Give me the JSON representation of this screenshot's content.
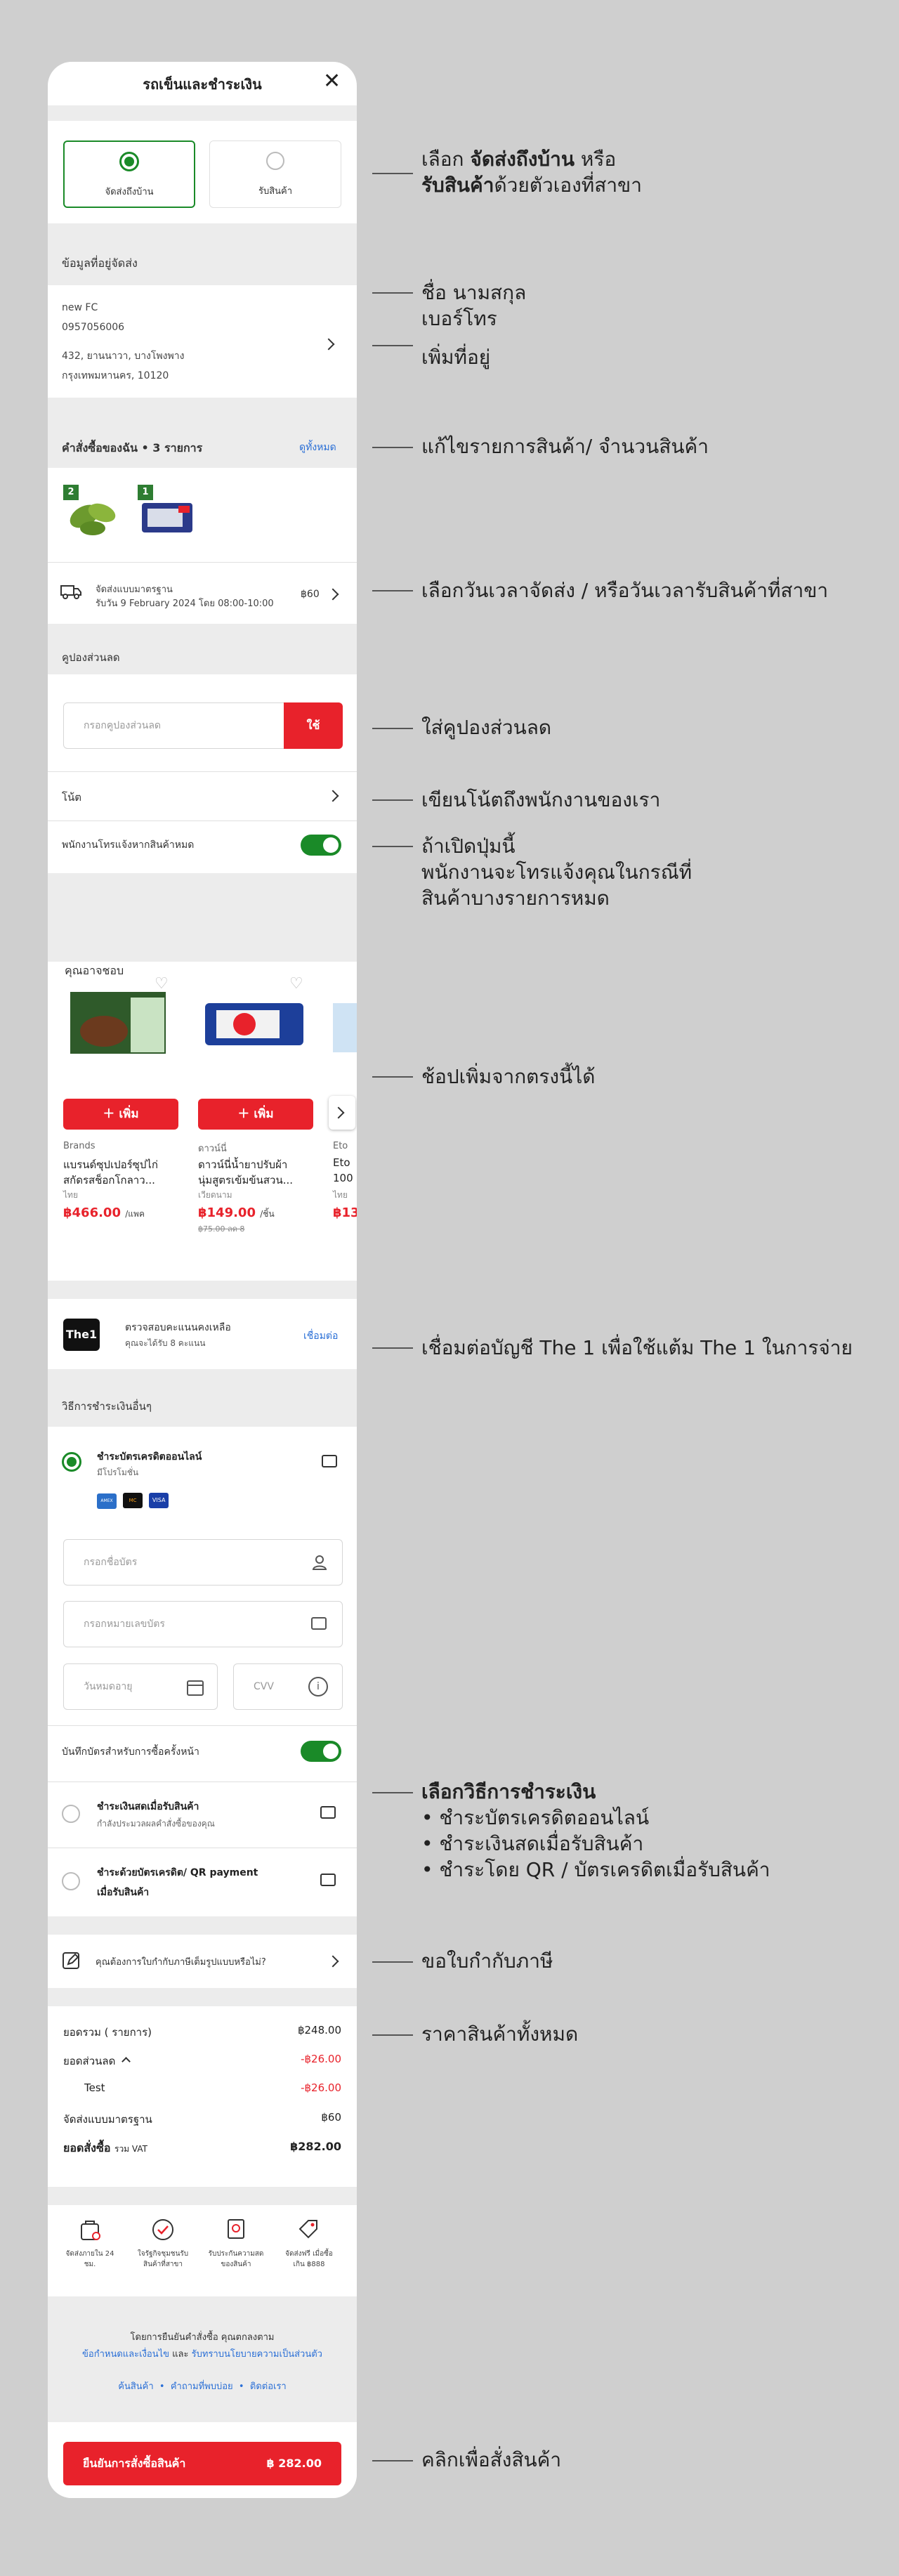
{
  "header": {
    "title": "รถเข็นและชำระเงิน"
  },
  "delivery": {
    "home_label": "จัดส่งถึงบ้าน",
    "pickup_label": "รับสินค้า"
  },
  "address": {
    "section_title": "ข้อมูลที่อยู่จัดส่ง",
    "name": "new FC",
    "phone": "0957056006",
    "line1": "432, ยานนาวา, บางโพงพาง",
    "line2": "กรุงเทพมหานคร, 10120"
  },
  "order": {
    "section_title": "คำสั่งซื้อของฉัน • 3 รายการ",
    "view_all": "ดูทั้งหมด",
    "item1_qty": "2",
    "item2_qty": "1",
    "shipping_title": "จัดส่งแบบมาตรฐาน",
    "shipping_date": "รับวัน 9 February 2024 โดย 08:00-10:00",
    "shipping_price": "฿60"
  },
  "coupon": {
    "section_title": "คูปองส่วนลด",
    "placeholder": "กรอกคูปองส่วนลด",
    "apply_label": "ใช้"
  },
  "note": {
    "label": "โน้ต"
  },
  "staff_call": {
    "label": "พนักงานโทรแจ้งหากสินค้าหมด"
  },
  "recommend": {
    "title": "คุณอาจชอบ",
    "products": [
      {
        "add_label": "เพิ่ม",
        "brand": "Brands",
        "name1": "แบรนด์ซุปเปอร์ซุปไก่",
        "name2": "สกัดรสช็อกโกลาว...",
        "origin": "ไทย",
        "price": "฿466.00",
        "unit": "/แพค",
        "old_price": ""
      },
      {
        "add_label": "เพิ่ม",
        "brand": "ดาวน์นี่",
        "name1": "ดาวน์นี่น้ำยาปรับผ้า",
        "name2": "นุ่มสูตรเข้มข้นสวน...",
        "origin": "เวียดนาม",
        "price": "฿149.00",
        "unit": "/ชิ้น",
        "old_price": "฿75.00 ลด 8"
      },
      {
        "add_label": "",
        "brand": "Eto",
        "name1": "Eto",
        "name2": "100",
        "origin": "ไทย",
        "price": "฿13",
        "unit": "",
        "old_price": ""
      }
    ]
  },
  "the1": {
    "logo": "The1",
    "title": "ตรวจสอบคะแนนคงเหลือ",
    "subtitle": "คุณจะได้รับ 8 คะแนน",
    "link": "เชื่อมต่อ"
  },
  "payment": {
    "section_title": "วิธีการชำระเงินอื่นๆ",
    "card_title": "ชำระบัตรเครดิตออนไลน์",
    "card_sub": "มีโปรโมชั่น",
    "card_logos": [
      "AMEX",
      "MC",
      "VISA"
    ],
    "card_name_ph": "กรอกชื่อบัตร",
    "card_number_ph": "กรอกหมายเลขบัตร",
    "expiry_ph": "วันหมดอายุ",
    "cvv_ph": "CVV",
    "save_card": "บันทึกบัตรสำหรับการซื้อครั้งหน้า",
    "cod_title": "ชำระเงินสดเมื่อรับสินค้า",
    "cod_sub": "กำลังประมวลผลคำสั่งซื้อของคุณ",
    "qr_title1": "ชำระด้วยบัตรเครดิต/ QR payment",
    "qr_title2": "เมื่อรับสินค้า"
  },
  "tax": {
    "label": "คุณต้องการใบกำกับภาษีเต็มรูปแบบหรือไม่?"
  },
  "summary": {
    "subtotal_label": "ยอดรวม ( รายการ)",
    "subtotal": "฿248.00",
    "discount_label": "ยอดส่วนลด",
    "discount": "-฿26.00",
    "test_label": "Test",
    "test_value": "-฿26.00",
    "shipping_label": "จัดส่งแบบมาตรฐาน",
    "shipping": "฿60",
    "total_label": "ยอดสั่งซื้อ",
    "vat": "รวม VAT",
    "total": "฿282.00"
  },
  "benefits": [
    {
      "line1": "จัดส่งภายใน 24",
      "line2": "ชม."
    },
    {
      "line1": "ใจรัฐกิจชุมชนรับ",
      "line2": "สินค้าที่สาขา"
    },
    {
      "line1": "รับประกันความสด",
      "line2": "ของสินค้า"
    },
    {
      "line1": "จัดส่งฟรี เมื่อซื้อ",
      "line2": "เกิน ฿888"
    }
  ],
  "terms": {
    "line1": "โดยการยืนยันคำสั่งซื้อ คุณตกลงตาม",
    "line2a": "ข้อกำหนดและเงื่อนไข",
    "line2b": " และ ",
    "line2c": "รับทราบนโยบายความเป็นส่วนตัว",
    "links": [
      "ค้นสินค้า",
      "คำถามที่พบบ่อย",
      "ติดต่อเรา"
    ]
  },
  "checkout": {
    "label": "ยืนยันการสั่งซื้อสินค้า",
    "total": "฿ 282.00"
  },
  "annotations": {
    "a1": "เลือก ",
    "a1b": "จัดส่งถึงบ้าน",
    "a1c": " หรือ",
    "a1d": "รับสินค้า",
    "a1e": "ด้วยตัวเองที่สาขา",
    "a2": "ชื่อ นามสกุล",
    "a2b": "เบอร์โทร",
    "a3": "เพิ่มที่อยู่",
    "a4": "แก้ไขรายการสินค้า/ จำนวนสินค้า",
    "a5": "เลือกวันเวลาจัดส่ง / หรือวันเวลารับสินค้าที่สาขา",
    "a6": "ใส่คูปองส่วนลด",
    "a7": "เขียนโน้ตถึงพนักงานของเรา",
    "a8": "ถ้าเปิดปุ่มนี้",
    "a8b": "พนักงานจะโทรแจ้งคุณในกรณีที่",
    "a8c": "สินค้าบางรายการหมด",
    "a9": "ช้อปเพิ่มจากตรงนี้ได้",
    "a10": "เชื่อมต่อบัญชี The 1 เพื่อใช้แต้ม The 1 ในการจ่าย",
    "a11": "เลือกวิธีการชำระเงิน",
    "a11b": "• ชำระบัตรเครดิตออนไลน์",
    "a11c": "• ชำระเงินสดเมื่อรับสินค้า",
    "a11d": "• ชำระโดย QR / บัตรเครดิตเมื่อรับสินค้า",
    "a12": "ขอใบกำกับภาษี",
    "a13": "ราคาสินค้าทั้งหมด",
    "a14": "คลิกเพื่อสั่งสินค้า"
  }
}
